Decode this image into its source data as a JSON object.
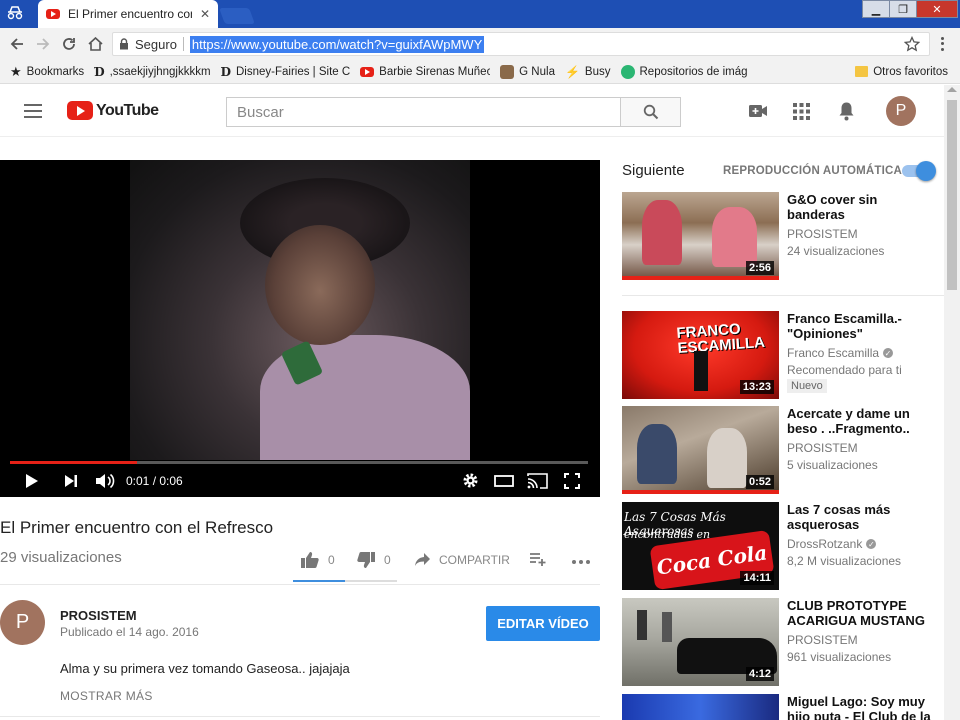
{
  "browser": {
    "tab_title": "El Primer encuentro con el Refresco",
    "security_label": "Seguro",
    "url": "https://www.youtube.com/watch?v=guixfAWpMWY",
    "bookmarks": [
      {
        "label": "Bookmarks",
        "icon": "star-icon"
      },
      {
        "label": ",ssaekjiyjhngjkkkkm",
        "icon": "disney-icon"
      },
      {
        "label": "Disney-Fairies | Site C",
        "icon": "disney-icon"
      },
      {
        "label": "Barbie Sirenas Muñec",
        "icon": "youtube-icon"
      },
      {
        "label": "G Nula",
        "icon": "image-icon"
      },
      {
        "label": "Busy",
        "icon": "bolt-icon"
      },
      {
        "label": "Repositorios de imág",
        "icon": "circle-icon"
      }
    ],
    "other_bookmarks": "Otros favoritos"
  },
  "youtube": {
    "logo_text": "YouTube",
    "search_placeholder": "Buscar",
    "avatar_letter": "P"
  },
  "video": {
    "current_time": "0:01 / 0:06",
    "progress": 0.22,
    "title": "El Primer encuentro con el Refresco",
    "views": "29 visualizaciones",
    "likes": "0",
    "dislikes": "0",
    "share_label": "COMPARTIR",
    "channel": "PROSISTEM",
    "channel_initial": "P",
    "published": "Publicado el 14 ago. 2016",
    "edit_label": "EDITAR VÍDEO",
    "description": "Alma y su primera vez tomando Gaseosa..  jajajaja",
    "show_more": "MOSTRAR MÁS"
  },
  "sidebar": {
    "next_label": "Siguiente",
    "autoplay_label": "REPRODUCCIÓN AUTOMÁTICA",
    "items": [
      {
        "title": "G&O cover sin banderas",
        "channel": "PROSISTEM",
        "views": "24 visualizaciones",
        "duration": "2:56"
      },
      {
        "title": "Franco Escamilla.- \"Opiniones\"",
        "channel": "Franco Escamilla",
        "views": "Recomendado para ti",
        "badge": "Nuevo",
        "duration": "13:23"
      },
      {
        "title": "Acercate y dame un beso . ..Fragmento..",
        "channel": "PROSISTEM",
        "views": "5 visualizaciones",
        "duration": "0:52"
      },
      {
        "title": "Las 7 cosas más asquerosas",
        "channel": "DrossRotzank",
        "views": "8,2 M visualizaciones",
        "duration": "14:11"
      },
      {
        "title": "CLUB PROTOTYPE ACARIGUA MUSTANG",
        "channel": "PROSISTEM",
        "views": "961 visualizaciones",
        "duration": "4:12"
      },
      {
        "title": "Miguel Lago: Soy muy hijo puta - El Club de la",
        "channel": "",
        "views": "",
        "duration": ""
      }
    ]
  },
  "colors": {
    "youtube_red": "#e62117",
    "blue_button": "#2a8ae8",
    "titlebar": "#1e4fb4",
    "toggle": "#3e8ede"
  }
}
